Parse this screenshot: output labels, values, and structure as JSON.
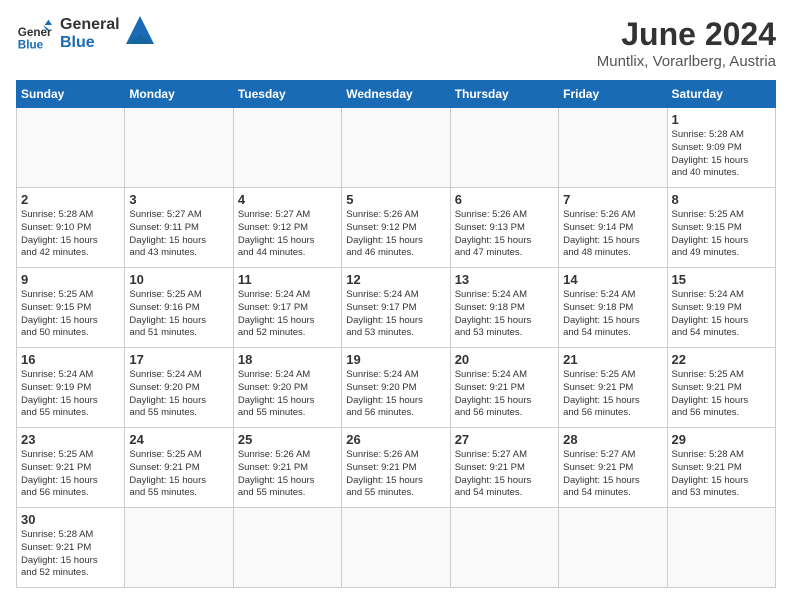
{
  "header": {
    "logo_general": "General",
    "logo_blue": "Blue",
    "month_title": "June 2024",
    "location": "Muntlix, Vorarlberg, Austria"
  },
  "days_of_week": [
    "Sunday",
    "Monday",
    "Tuesday",
    "Wednesday",
    "Thursday",
    "Friday",
    "Saturday"
  ],
  "weeks": [
    [
      {
        "day": "",
        "info": ""
      },
      {
        "day": "",
        "info": ""
      },
      {
        "day": "",
        "info": ""
      },
      {
        "day": "",
        "info": ""
      },
      {
        "day": "",
        "info": ""
      },
      {
        "day": "",
        "info": ""
      },
      {
        "day": "1",
        "info": "Sunrise: 5:28 AM\nSunset: 9:09 PM\nDaylight: 15 hours\nand 40 minutes."
      }
    ],
    [
      {
        "day": "2",
        "info": "Sunrise: 5:28 AM\nSunset: 9:10 PM\nDaylight: 15 hours\nand 42 minutes."
      },
      {
        "day": "3",
        "info": "Sunrise: 5:27 AM\nSunset: 9:11 PM\nDaylight: 15 hours\nand 43 minutes."
      },
      {
        "day": "4",
        "info": "Sunrise: 5:27 AM\nSunset: 9:12 PM\nDaylight: 15 hours\nand 44 minutes."
      },
      {
        "day": "5",
        "info": "Sunrise: 5:26 AM\nSunset: 9:12 PM\nDaylight: 15 hours\nand 46 minutes."
      },
      {
        "day": "6",
        "info": "Sunrise: 5:26 AM\nSunset: 9:13 PM\nDaylight: 15 hours\nand 47 minutes."
      },
      {
        "day": "7",
        "info": "Sunrise: 5:26 AM\nSunset: 9:14 PM\nDaylight: 15 hours\nand 48 minutes."
      },
      {
        "day": "8",
        "info": "Sunrise: 5:25 AM\nSunset: 9:15 PM\nDaylight: 15 hours\nand 49 minutes."
      }
    ],
    [
      {
        "day": "9",
        "info": "Sunrise: 5:25 AM\nSunset: 9:15 PM\nDaylight: 15 hours\nand 50 minutes."
      },
      {
        "day": "10",
        "info": "Sunrise: 5:25 AM\nSunset: 9:16 PM\nDaylight: 15 hours\nand 51 minutes."
      },
      {
        "day": "11",
        "info": "Sunrise: 5:24 AM\nSunset: 9:17 PM\nDaylight: 15 hours\nand 52 minutes."
      },
      {
        "day": "12",
        "info": "Sunrise: 5:24 AM\nSunset: 9:17 PM\nDaylight: 15 hours\nand 53 minutes."
      },
      {
        "day": "13",
        "info": "Sunrise: 5:24 AM\nSunset: 9:18 PM\nDaylight: 15 hours\nand 53 minutes."
      },
      {
        "day": "14",
        "info": "Sunrise: 5:24 AM\nSunset: 9:18 PM\nDaylight: 15 hours\nand 54 minutes."
      },
      {
        "day": "15",
        "info": "Sunrise: 5:24 AM\nSunset: 9:19 PM\nDaylight: 15 hours\nand 54 minutes."
      }
    ],
    [
      {
        "day": "16",
        "info": "Sunrise: 5:24 AM\nSunset: 9:19 PM\nDaylight: 15 hours\nand 55 minutes."
      },
      {
        "day": "17",
        "info": "Sunrise: 5:24 AM\nSunset: 9:20 PM\nDaylight: 15 hours\nand 55 minutes."
      },
      {
        "day": "18",
        "info": "Sunrise: 5:24 AM\nSunset: 9:20 PM\nDaylight: 15 hours\nand 55 minutes."
      },
      {
        "day": "19",
        "info": "Sunrise: 5:24 AM\nSunset: 9:20 PM\nDaylight: 15 hours\nand 56 minutes."
      },
      {
        "day": "20",
        "info": "Sunrise: 5:24 AM\nSunset: 9:21 PM\nDaylight: 15 hours\nand 56 minutes."
      },
      {
        "day": "21",
        "info": "Sunrise: 5:25 AM\nSunset: 9:21 PM\nDaylight: 15 hours\nand 56 minutes."
      },
      {
        "day": "22",
        "info": "Sunrise: 5:25 AM\nSunset: 9:21 PM\nDaylight: 15 hours\nand 56 minutes."
      }
    ],
    [
      {
        "day": "23",
        "info": "Sunrise: 5:25 AM\nSunset: 9:21 PM\nDaylight: 15 hours\nand 56 minutes."
      },
      {
        "day": "24",
        "info": "Sunrise: 5:25 AM\nSunset: 9:21 PM\nDaylight: 15 hours\nand 55 minutes."
      },
      {
        "day": "25",
        "info": "Sunrise: 5:26 AM\nSunset: 9:21 PM\nDaylight: 15 hours\nand 55 minutes."
      },
      {
        "day": "26",
        "info": "Sunrise: 5:26 AM\nSunset: 9:21 PM\nDaylight: 15 hours\nand 55 minutes."
      },
      {
        "day": "27",
        "info": "Sunrise: 5:27 AM\nSunset: 9:21 PM\nDaylight: 15 hours\nand 54 minutes."
      },
      {
        "day": "28",
        "info": "Sunrise: 5:27 AM\nSunset: 9:21 PM\nDaylight: 15 hours\nand 54 minutes."
      },
      {
        "day": "29",
        "info": "Sunrise: 5:28 AM\nSunset: 9:21 PM\nDaylight: 15 hours\nand 53 minutes."
      }
    ],
    [
      {
        "day": "30",
        "info": "Sunrise: 5:28 AM\nSunset: 9:21 PM\nDaylight: 15 hours\nand 52 minutes."
      },
      {
        "day": "",
        "info": ""
      },
      {
        "day": "",
        "info": ""
      },
      {
        "day": "",
        "info": ""
      },
      {
        "day": "",
        "info": ""
      },
      {
        "day": "",
        "info": ""
      },
      {
        "day": "",
        "info": ""
      }
    ]
  ]
}
